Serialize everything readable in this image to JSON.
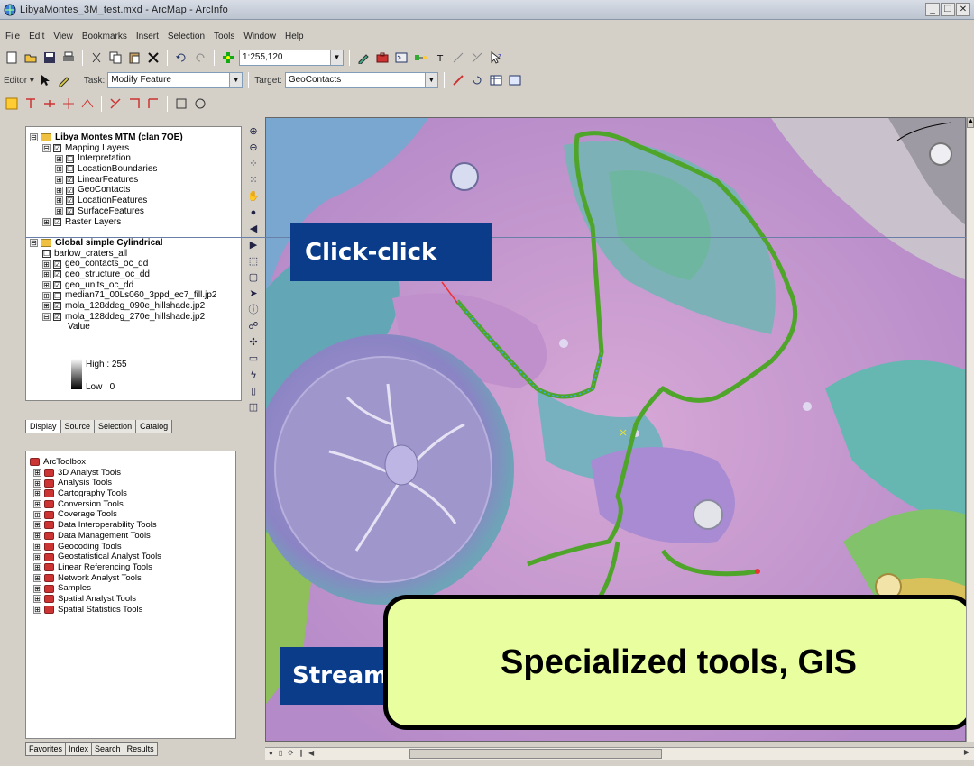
{
  "window": {
    "title": "LibyaMontes_3M_test.mxd - ArcMap - ArcInfo"
  },
  "menu": [
    "File",
    "Edit",
    "View",
    "Bookmarks",
    "Insert",
    "Selection",
    "Tools",
    "Window",
    "Help"
  ],
  "toolbar": {
    "scale": "1:255,120",
    "editor_label": "Editor ▾",
    "task_label": "Task:",
    "task_value": "Modify Feature",
    "target_label": "Target:",
    "target_value": "GeoContacts"
  },
  "toc": {
    "layers": [
      {
        "indent": 0,
        "exp": "⊟",
        "check": "",
        "folder": true,
        "text": "Libya Montes MTM (clan 7OE)"
      },
      {
        "indent": 1,
        "exp": "⊟",
        "check": "☑",
        "folder": false,
        "text": "Mapping Layers"
      },
      {
        "indent": 2,
        "exp": "⊞",
        "check": "☐",
        "folder": false,
        "text": "Interpretation"
      },
      {
        "indent": 2,
        "exp": "⊞",
        "check": "☐",
        "folder": false,
        "text": "LocationBoundaries"
      },
      {
        "indent": 2,
        "exp": "⊞",
        "check": "☑",
        "folder": false,
        "text": "LinearFeatures"
      },
      {
        "indent": 2,
        "exp": "⊞",
        "check": "☑",
        "folder": false,
        "text": "GeoContacts"
      },
      {
        "indent": 2,
        "exp": "⊞",
        "check": "☑",
        "folder": false,
        "text": "LocationFeatures"
      },
      {
        "indent": 2,
        "exp": "⊞",
        "check": "☑",
        "folder": false,
        "text": "SurfaceFeatures"
      },
      {
        "indent": 1,
        "exp": "⊞",
        "check": "☑",
        "folder": false,
        "text": "Raster Layers"
      },
      {
        "indent": 0,
        "exp": "",
        "check": "",
        "folder": false,
        "text": ""
      },
      {
        "indent": 0,
        "exp": "⊟",
        "check": "",
        "folder": true,
        "text": "Global simple Cylindrical"
      },
      {
        "indent": 1,
        "exp": "",
        "check": "☐",
        "folder": false,
        "text": "barlow_craters_all"
      },
      {
        "indent": 1,
        "exp": "⊞",
        "check": "☑",
        "folder": false,
        "text": "geo_contacts_oc_dd"
      },
      {
        "indent": 1,
        "exp": "⊞",
        "check": "☑",
        "folder": false,
        "text": "geo_structure_oc_dd"
      },
      {
        "indent": 1,
        "exp": "⊞",
        "check": "☑",
        "folder": false,
        "text": "geo_units_oc_dd"
      },
      {
        "indent": 1,
        "exp": "⊞",
        "check": "☐",
        "folder": false,
        "text": "median71_00Ls060_3ppd_ec7_fill.jp2"
      },
      {
        "indent": 1,
        "exp": "⊞",
        "check": "☑",
        "folder": false,
        "text": "mola_128ddeg_090e_hillshade.jp2"
      },
      {
        "indent": 1,
        "exp": "⊟",
        "check": "☑",
        "folder": false,
        "text": "mola_128ddeg_270e_hillshade.jp2"
      },
      {
        "indent": 3,
        "exp": "",
        "check": "",
        "folder": false,
        "text": "Value"
      }
    ],
    "legend_high": "High : 255",
    "legend_low": "Low : 0",
    "tabs": [
      "Display",
      "Source",
      "Selection",
      "Catalog"
    ]
  },
  "toolbox": {
    "root": "ArcToolbox",
    "items": [
      "3D Analyst Tools",
      "Analysis Tools",
      "Cartography Tools",
      "Conversion Tools",
      "Coverage Tools",
      "Data Interoperability Tools",
      "Data Management Tools",
      "Geocoding Tools",
      "Geostatistical Analyst Tools",
      "Linear Referencing Tools",
      "Network Analyst Tools",
      "Samples",
      "Spatial Analyst Tools",
      "Spatial Statistics Tools"
    ],
    "tabs": [
      "Favorites",
      "Index",
      "Search",
      "Results"
    ]
  },
  "map": {
    "label_click": "Click-click",
    "label_stream": "Stream",
    "callout": "Specialized tools, GIS"
  },
  "colors": {
    "label_bg": "#0b3c8a",
    "callout_bg": "#e9ff9f",
    "trace": "#4ea52a"
  }
}
